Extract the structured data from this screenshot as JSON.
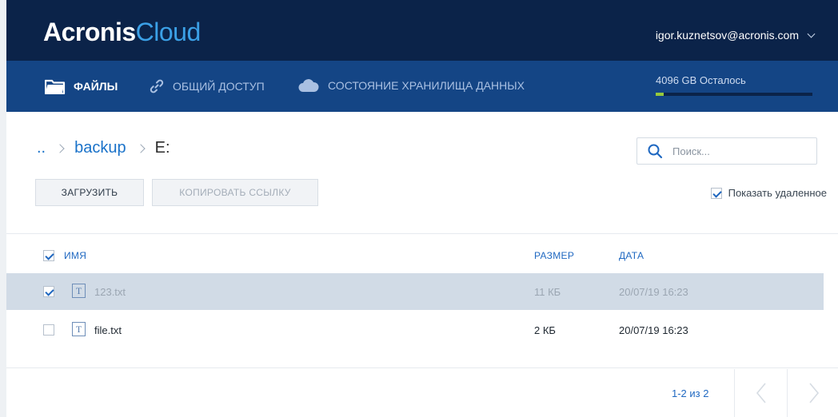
{
  "header": {
    "logo_primary": "Acronis",
    "logo_secondary": "Cloud",
    "user_email": "igor.kuznetsov@acronis.com"
  },
  "nav": {
    "items": [
      {
        "label": "ФАЙЛЫ",
        "icon": "folder-icon",
        "active": true
      },
      {
        "label": "ОБЩИЙ ДОСТУП",
        "icon": "link-icon",
        "active": false
      },
      {
        "label": "СОСТОЯНИЕ ХРАНИЛИЩА ДАННЫХ",
        "icon": "cloud-icon",
        "active": false
      }
    ],
    "storage_label": "4096 GB Осталось",
    "storage_used_fraction": 0.05
  },
  "breadcrumb": {
    "items": [
      "..",
      "backup",
      "E:"
    ]
  },
  "search": {
    "placeholder": "Поиск..."
  },
  "toolbar": {
    "upload_label": "ЗАГРУЗИТЬ",
    "copy_link_label": "КОПИРОВАТЬ ССЫЛКУ",
    "show_deleted_label": "Показать удаленное",
    "show_deleted_checked": true
  },
  "table": {
    "columns": {
      "name": "ИМЯ",
      "size": "РАЗМЕР",
      "date": "ДАТА"
    },
    "header_checked": true,
    "rows": [
      {
        "icon_letter": "T",
        "name": "123.txt",
        "size": "11 КБ",
        "date": "20/07/19 16:23",
        "selected": true
      },
      {
        "icon_letter": "T",
        "name": "file.txt",
        "size": "2 КБ",
        "date": "20/07/19 16:23",
        "selected": false
      }
    ]
  },
  "pagination": {
    "text": "1-2 из 2"
  },
  "colors": {
    "topbar": "#0b2349",
    "navbar": "#144585",
    "accent": "#1f68c1",
    "storage_fill": "#96c83c",
    "selected_row": "#d1dbe6"
  }
}
